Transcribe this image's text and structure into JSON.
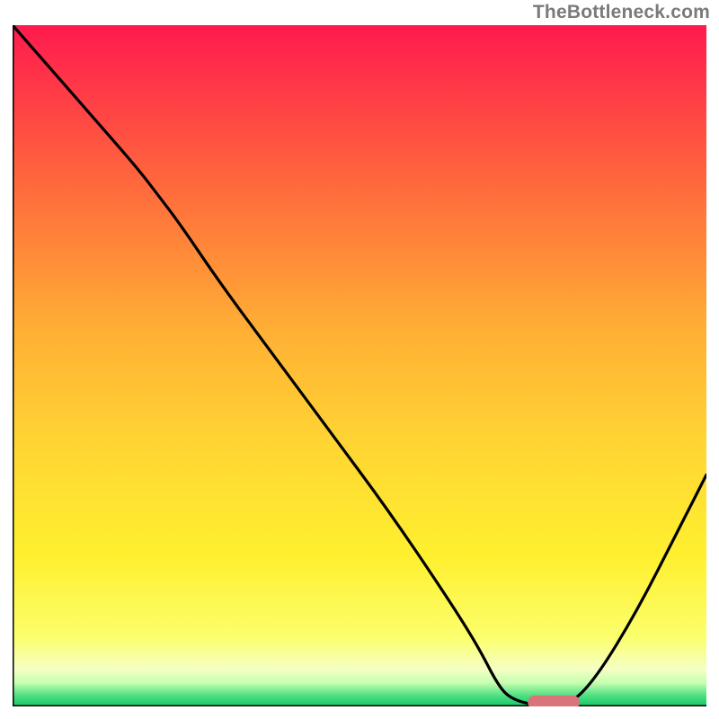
{
  "attribution": "TheBottleneck.com",
  "chart_data": {
    "type": "line",
    "title": "",
    "xlabel": "",
    "ylabel": "",
    "xlim": [
      0,
      100
    ],
    "ylim": [
      0,
      100
    ],
    "background_gradient": {
      "stops": [
        {
          "pos": 0,
          "color": "#ff1a4d"
        },
        {
          "pos": 0.06,
          "color": "#ff2e49"
        },
        {
          "pos": 0.25,
          "color": "#ff6e3c"
        },
        {
          "pos": 0.45,
          "color": "#ffb035"
        },
        {
          "pos": 0.62,
          "color": "#ffd633"
        },
        {
          "pos": 0.78,
          "color": "#fff02f"
        },
        {
          "pos": 0.9,
          "color": "#fbff6e"
        },
        {
          "pos": 0.945,
          "color": "#f6ffc4"
        },
        {
          "pos": 0.965,
          "color": "#c8ffb0"
        },
        {
          "pos": 0.985,
          "color": "#4ade80"
        },
        {
          "pos": 1.0,
          "color": "#15c66a"
        }
      ]
    },
    "series": [
      {
        "name": "bottleneck-curve",
        "color": "#000000",
        "x": [
          0,
          6,
          12,
          18,
          21,
          24,
          30,
          38,
          46,
          54,
          62,
          67,
          70,
          72,
          76,
          80,
          84,
          90,
          96,
          100
        ],
        "y": [
          100,
          93,
          86,
          79,
          75,
          71,
          62,
          51,
          40,
          29,
          17,
          9,
          3,
          1,
          0,
          0,
          4,
          14,
          26,
          34
        ]
      }
    ],
    "marker": {
      "name": "optimal-range",
      "shape": "capsule",
      "color": "#d9757a",
      "x_center": 78,
      "y_center": 0.6,
      "width": 7.5,
      "height": 2.0
    },
    "axes": {
      "left": true,
      "bottom": true,
      "color": "#000000",
      "width": 3
    }
  }
}
